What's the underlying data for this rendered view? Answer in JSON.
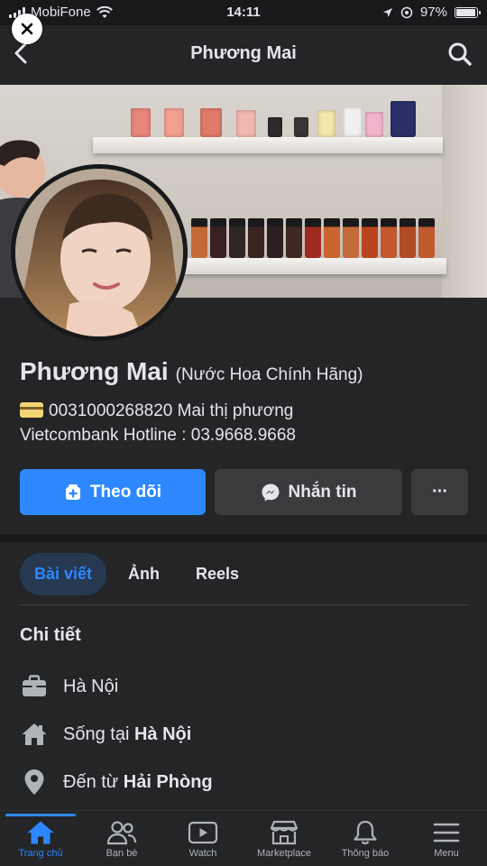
{
  "status_bar": {
    "carrier": "MobiFone",
    "time": "14:11",
    "battery": "97%",
    "battery_level": 0.97
  },
  "header": {
    "title": "Phương Mai"
  },
  "profile": {
    "name": "Phương Mai",
    "subtitle": "(Nước Hoa Chính Hãng)",
    "bio_line1": "0031000268820 Mai thị phương",
    "bio_line2": "Vietcombank Hotline : 03.9668.9668"
  },
  "actions": {
    "follow_label": "Theo dõi",
    "message_label": "Nhắn tin",
    "more_label": "···"
  },
  "tabs": [
    {
      "label": "Bài viết",
      "active": true
    },
    {
      "label": "Ảnh",
      "active": false
    },
    {
      "label": "Reels",
      "active": false
    }
  ],
  "details": {
    "title": "Chi tiết",
    "items": [
      {
        "icon": "briefcase-icon",
        "text": "Hà Nội",
        "bold": ""
      },
      {
        "icon": "home-icon",
        "text": "Sống tại ",
        "bold": "Hà Nội"
      },
      {
        "icon": "location-pin-icon",
        "text": "Đến từ ",
        "bold": "Hải Phòng"
      }
    ]
  },
  "bottom_nav": [
    {
      "label": "Trang chủ",
      "icon": "home-icon",
      "active": true
    },
    {
      "label": "Bạn bè",
      "icon": "friends-icon",
      "active": false
    },
    {
      "label": "Watch",
      "icon": "watch-icon",
      "active": false
    },
    {
      "label": "Marketplace",
      "icon": "marketplace-icon",
      "active": false
    },
    {
      "label": "Thông báo",
      "icon": "bell-icon",
      "active": false
    },
    {
      "label": "Menu",
      "icon": "menu-icon",
      "active": false
    }
  ],
  "colors": {
    "accent": "#2d88ff",
    "background": "#242526",
    "surface": "#3a3b3c",
    "text": "#e4e6eb"
  }
}
